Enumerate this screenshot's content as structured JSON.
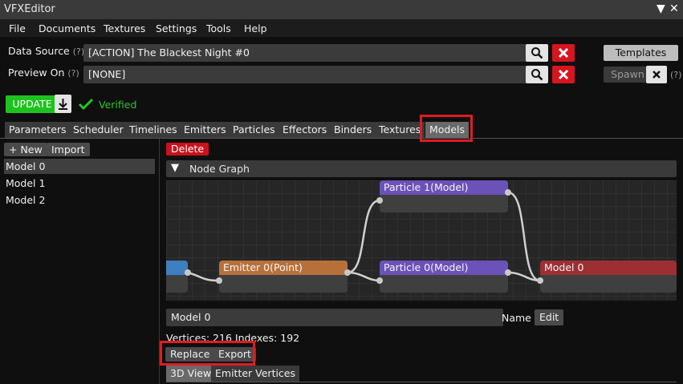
{
  "window": {
    "title": "VFXEditor"
  },
  "menu": [
    "File",
    "Documents",
    "Textures",
    "Settings",
    "Tools",
    "Help"
  ],
  "data_source": {
    "label": "Data Source",
    "hint": "(?)",
    "value": "[ACTION] The Blackest Night #0"
  },
  "preview_on": {
    "label": "Preview On",
    "hint": "(?)",
    "value": "[NONE]"
  },
  "side_buttons": {
    "templates": "Templates",
    "spawn": "Spawn",
    "hint": "(?)"
  },
  "status": {
    "update": "UPDATE",
    "verified": "Verified"
  },
  "tabs": [
    "Parameters",
    "Scheduler",
    "Timelines",
    "Emitters",
    "Particles",
    "Effectors",
    "Binders",
    "Textures",
    "Models"
  ],
  "left_panel": {
    "new": "+ New",
    "import": "Import",
    "items": [
      "Model 0",
      "Model 1",
      "Model 2"
    ]
  },
  "main": {
    "delete": "Delete",
    "node_graph_header": "Node Graph",
    "nodes": {
      "emitter": "Emitter 0(Point)",
      "particle1": "Particle 1(Model)",
      "particle0": "Particle 0(Model)",
      "model": "Model 0"
    },
    "name_field": {
      "value": "Model 0",
      "label": "Name",
      "edit": "Edit"
    },
    "stats": "Vertices: 216 Indexes: 192",
    "replace": "Replace",
    "export": "Export",
    "subtabs": [
      "3D View",
      "Emitter Vertices"
    ]
  },
  "colors": {
    "emitter": "#b8703a",
    "particle": "#6a52b8",
    "model": "#9c2f34",
    "blue_node": "#3f7fbf",
    "update_green": "#1ec21e",
    "delete_red": "#c8121c",
    "highlight": "#e01b24"
  }
}
